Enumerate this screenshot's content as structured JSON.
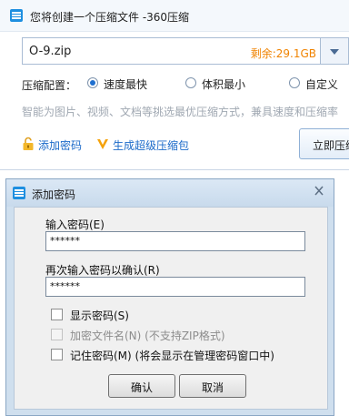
{
  "main_window": {
    "title": "您将创建一个压缩文件 -360压缩",
    "archive_name": "O-9.zip",
    "free_space": "剩余:29.1GB",
    "config_label": "压缩配置：",
    "options": [
      {
        "label": "速度最快",
        "checked": true
      },
      {
        "label": "体积最小",
        "checked": false
      },
      {
        "label": "自定义",
        "checked": false
      }
    ],
    "hint": "智能为图片、视频、文档等挑选最优压缩方式，兼具速度和压缩率",
    "add_password_link": "添加密码",
    "super_compress_link": "生成超级压缩包",
    "compress_now_button": "立即压缩"
  },
  "password_dialog": {
    "title": "添加密码",
    "enter_password_label": "输入密码(E)",
    "enter_password_value": "******",
    "confirm_password_label": "再次输入密码以确认(R)",
    "confirm_password_value": "******",
    "show_password": "显示密码(S)",
    "encrypt_filenames": "加密文件名(N) (不支持ZIP格式)",
    "remember_password": "记住密码(M) (将会显示在管理密码窗口中)",
    "ok_button": "确认",
    "cancel_button": "取消"
  },
  "colors": {
    "link": "#1b6ac9",
    "free_space": "#f08300",
    "radio_checked": "#1f6fcf"
  }
}
